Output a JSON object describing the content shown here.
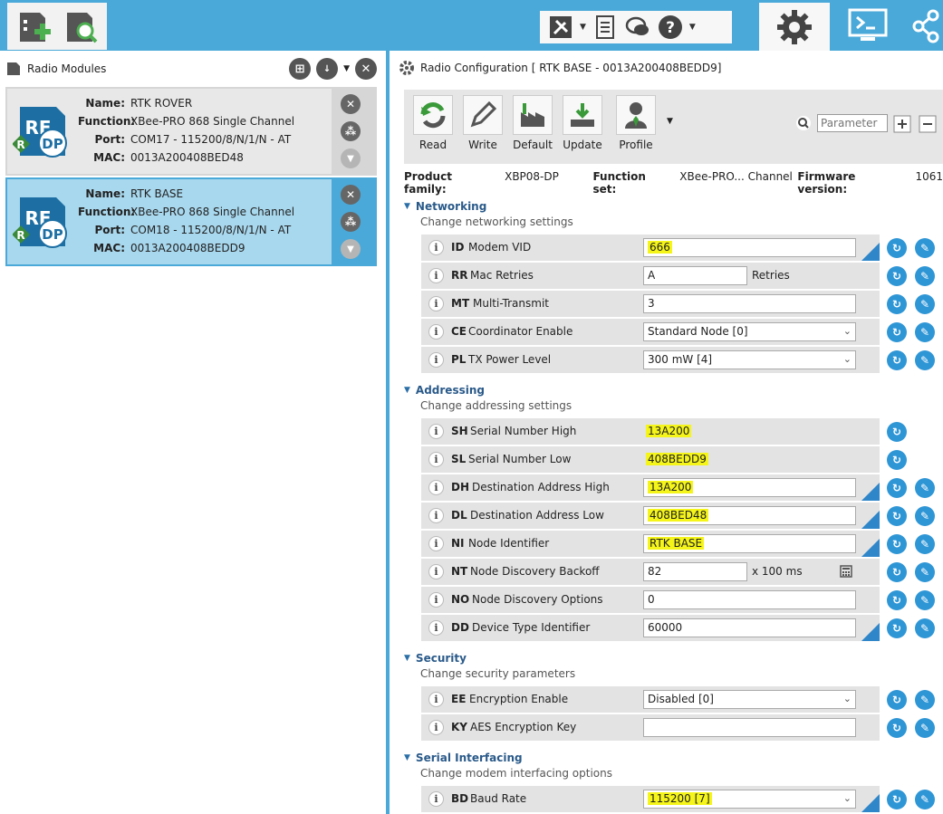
{
  "left": {
    "title": "Radio Modules",
    "modules": [
      {
        "name_label": "Name:",
        "name": "RTK ROVER",
        "function_label": "Function:",
        "function": "XBee-PRO 868 Single Channel",
        "port_label": "Port:",
        "port": "COM17 - 115200/8/N/1/N - AT",
        "mac_label": "MAC:",
        "mac": "0013A200408BED48"
      },
      {
        "name_label": "Name:",
        "name": "RTK BASE",
        "function_label": "Function:",
        "function": "XBee-PRO 868 Single Channel",
        "port_label": "Port:",
        "port": "COM18 - 115200/8/N/1/N - AT",
        "mac_label": "MAC:",
        "mac": "0013A200408BEDD9"
      }
    ],
    "logo_text_rf": "RF",
    "logo_text_dp": "DP",
    "logo_text_r": "R"
  },
  "right": {
    "title": "Radio Configuration [ RTK BASE - 0013A200408BEDD9]",
    "toolbar": {
      "read": "Read",
      "write": "Write",
      "default": "Default",
      "update": "Update",
      "profile": "Profile"
    },
    "search_placeholder": "Parameter",
    "product_family_label": "Product family:",
    "product_family": "XBP08-DP",
    "function_set_label": "Function set:",
    "function_set": "XBee-PRO... Channel",
    "firmware_label": "Firmware version:",
    "firmware": "1061",
    "sections": {
      "networking": {
        "title": "Networking",
        "desc": "Change networking settings"
      },
      "addressing": {
        "title": "Addressing",
        "desc": "Change addressing settings"
      },
      "security": {
        "title": "Security",
        "desc": "Change security parameters"
      },
      "serial": {
        "title": "Serial Interfacing",
        "desc": "Change modem interfacing options"
      }
    },
    "params": {
      "id": {
        "code": "ID",
        "name": "Modem VID",
        "value": "666"
      },
      "rr": {
        "code": "RR",
        "name": "Mac Retries",
        "value": "A",
        "unit": "Retries"
      },
      "mt": {
        "code": "MT",
        "name": "Multi-Transmit",
        "value": "3"
      },
      "ce": {
        "code": "CE",
        "name": "Coordinator Enable",
        "value": "Standard Node [0]"
      },
      "pl": {
        "code": "PL",
        "name": "TX Power Level",
        "value": "300 mW [4]"
      },
      "sh": {
        "code": "SH",
        "name": "Serial Number High",
        "value": "13A200"
      },
      "sl": {
        "code": "SL",
        "name": "Serial Number Low",
        "value": "408BEDD9"
      },
      "dh": {
        "code": "DH",
        "name": "Destination Address High",
        "value": "13A200"
      },
      "dl": {
        "code": "DL",
        "name": "Destination Address Low",
        "value": "408BED48"
      },
      "ni": {
        "code": "NI",
        "name": "Node Identifier",
        "value": "RTK BASE"
      },
      "nt": {
        "code": "NT",
        "name": "Node Discovery Backoff",
        "value": "82",
        "unit": "x 100 ms"
      },
      "no": {
        "code": "NO",
        "name": "Node Discovery Options",
        "value": "0"
      },
      "dd": {
        "code": "DD",
        "name": "Device Type Identifier",
        "value": "60000"
      },
      "ee": {
        "code": "EE",
        "name": "Encryption Enable",
        "value": "Disabled [0]"
      },
      "ky": {
        "code": "KY",
        "name": "AES Encryption Key",
        "value": ""
      },
      "bd": {
        "code": "BD",
        "name": "Baud Rate",
        "value": "115200 [7]"
      }
    }
  },
  "colors": {
    "accent": "#4aa9d9",
    "selected": "#a8d8ee",
    "action": "#2f96d6",
    "highlight": "#f5f51a"
  }
}
